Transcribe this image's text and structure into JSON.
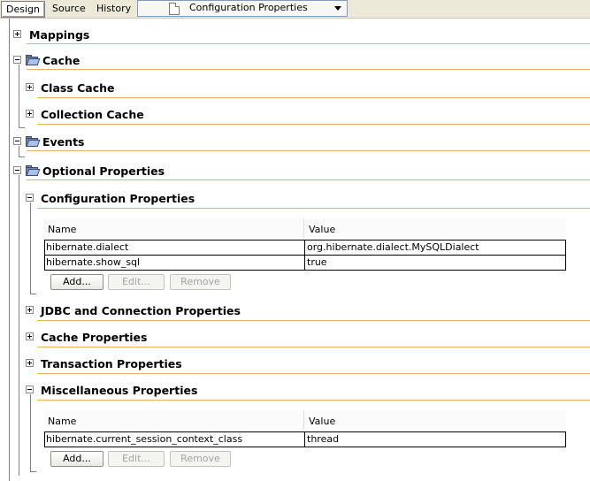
{
  "toolbar": {
    "tabs": [
      "Design",
      "Source",
      "History"
    ],
    "view_select": "Configuration Properties"
  },
  "sections": {
    "mappings": "Mappings",
    "cache": "Cache",
    "class_cache": "Class Cache",
    "collection_cache": "Collection Cache",
    "events": "Events",
    "optional_properties": "Optional Properties",
    "configuration_properties": "Configuration Properties",
    "jdbc": "JDBC and Connection Properties",
    "cache_properties": "Cache Properties",
    "transaction_properties": "Transaction Properties",
    "misc_properties": "Miscellaneous Properties"
  },
  "config_table": {
    "columns": [
      "Name",
      "Value"
    ],
    "rows": [
      {
        "name": "hibernate.dialect",
        "value": "org.hibernate.dialect.MySQLDialect"
      },
      {
        "name": "hibernate.show_sql",
        "value": "true"
      }
    ]
  },
  "misc_table": {
    "columns": [
      "Name",
      "Value"
    ],
    "rows": [
      {
        "name": "hibernate.current_session_context_class",
        "value": "thread"
      }
    ]
  },
  "buttons": {
    "add": "Add...",
    "edit": "Edit...",
    "remove": "Remove"
  },
  "icons": [
    "expand-icon",
    "collapse-icon",
    "folder-icon",
    "document-icon",
    "dropdown-arrow-icon"
  ]
}
